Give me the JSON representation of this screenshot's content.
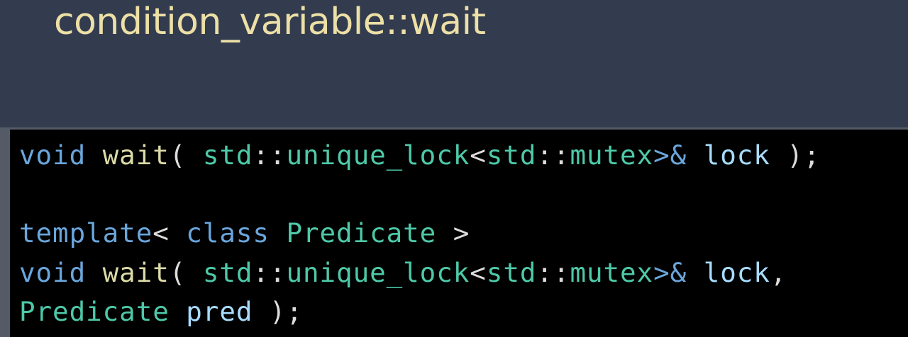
{
  "slide": {
    "title": "condition_variable::wait"
  },
  "code": {
    "line1": {
      "kw_void": "void",
      "fn_wait": " wait",
      "paren_open": "( ",
      "ns_std": "std",
      "sep1": "::",
      "type_unique_lock": "unique_lock",
      "lt": "<",
      "ns_std2": "std",
      "sep2": "::",
      "type_mutex": "mutex",
      "gt_ref": ">& ",
      "var_lock": "lock",
      "close": " );"
    },
    "line2": {
      "kw_template": "template",
      "lt": "< ",
      "kw_class": "class",
      "space": " ",
      "type_predicate": "Predicate",
      "gt": " >"
    },
    "line3": {
      "kw_void": "void",
      "fn_wait": " wait",
      "paren_open": "( ",
      "ns_std": "std",
      "sep1": "::",
      "type_unique_lock": "unique_lock",
      "lt": "<",
      "ns_std2": "std",
      "sep2": "::",
      "type_mutex": "mutex",
      "gt_ref": ">& ",
      "var_lock": "lock",
      "comma": ","
    },
    "line4": {
      "type_predicate": "Predicate",
      "space": " ",
      "var_pred": "pred",
      "close": " );"
    }
  },
  "colors": {
    "background": "#333c4f",
    "title": "#ede0a6",
    "code_background": "#000000",
    "keyword": "#6aa6dc",
    "function": "#dcdba8",
    "type": "#4ec9a8",
    "variable": "#a8dcfe",
    "punctuation": "#dcdcdc"
  }
}
